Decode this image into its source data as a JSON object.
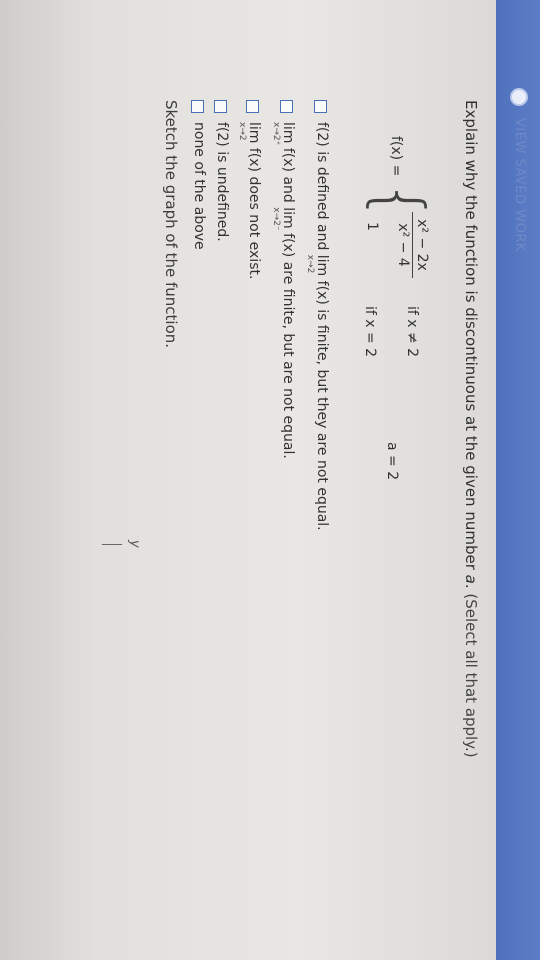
{
  "header": {
    "label": "VIEW SAVED WORK"
  },
  "question": {
    "prompt_start": "Explain why the function is discontinuous at the given number ",
    "a_symbol": "a",
    "prompt_end": ". ",
    "hint": "(Select all that apply.)"
  },
  "piecewise": {
    "fx": "f(x) =",
    "numerator": "x² − 2x",
    "denominator": "x² − 4",
    "cond1": "if x ≠ 2",
    "value2": "1",
    "cond2": "if x = 2",
    "a_value": "a = 2"
  },
  "options": [
    {
      "id": "opt1",
      "text_pre": "f(2) is defined and ",
      "lim_word": "lim",
      "lim_sub": "x→2",
      "text_post": " f(x) is finite, but they are not equal."
    },
    {
      "id": "opt2",
      "lim_word_a": "lim",
      "lim_sub_a": "x→2⁺",
      "text_mid": " f(x) and ",
      "lim_word_b": "lim",
      "lim_sub_b": "x→2⁻",
      "text_post": " f(x) are finite, but are not equal."
    },
    {
      "id": "opt3",
      "lim_word": "lim",
      "lim_sub": "x→2",
      "text_post": " f(x) does not exist."
    },
    {
      "id": "opt4",
      "text": "f(2) is undefined."
    },
    {
      "id": "opt5",
      "text": "none of the above"
    }
  ],
  "sketch": {
    "prompt": "Sketch the graph of the function.",
    "axis_label": "y"
  }
}
